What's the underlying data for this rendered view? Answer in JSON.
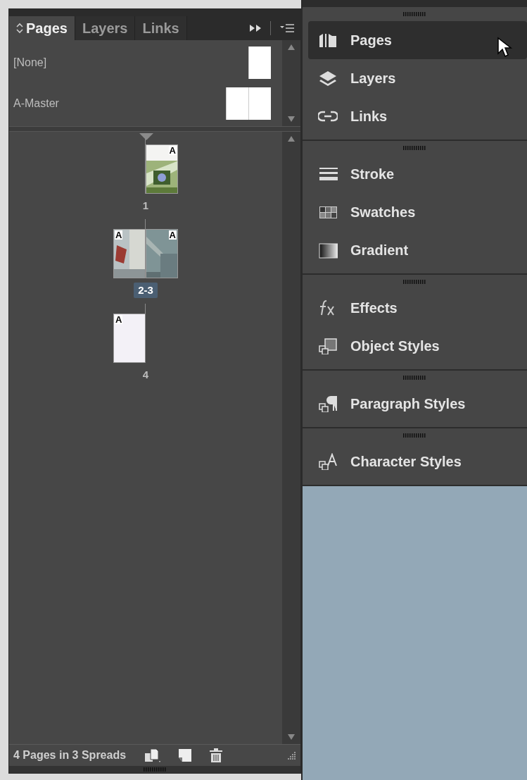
{
  "pages_panel": {
    "tabs": [
      {
        "label": "Pages",
        "selected": true
      },
      {
        "label": "Layers",
        "selected": false
      },
      {
        "label": "Links",
        "selected": false
      }
    ],
    "masters": [
      {
        "name": "[None]",
        "kind": "single"
      },
      {
        "name": "A-Master",
        "kind": "spread"
      }
    ],
    "spreads": [
      {
        "label": "1",
        "selected": false,
        "pages": [
          {
            "recto": true,
            "master": "A",
            "kind": "photo-green"
          }
        ]
      },
      {
        "label": "2-3",
        "selected": true,
        "pages": [
          {
            "recto": false,
            "master": "A",
            "kind": "photo-red"
          },
          {
            "recto": true,
            "master": "A",
            "kind": "photo-grey"
          }
        ]
      },
      {
        "label": "4",
        "selected": false,
        "pages": [
          {
            "recto": false,
            "master": "A",
            "kind": "blank"
          }
        ]
      }
    ],
    "status": "4 Pages in 3 Spreads"
  },
  "dock": {
    "groups": [
      {
        "items": [
          {
            "label": "Pages",
            "kind": "pages",
            "selected": true
          },
          {
            "label": "Layers",
            "kind": "layers",
            "selected": false
          },
          {
            "label": "Links",
            "kind": "links",
            "selected": false
          }
        ]
      },
      {
        "items": [
          {
            "label": "Stroke",
            "kind": "stroke",
            "selected": false
          },
          {
            "label": "Swatches",
            "kind": "swatches",
            "selected": false
          },
          {
            "label": "Gradient",
            "kind": "gradient",
            "selected": false
          }
        ]
      },
      {
        "items": [
          {
            "label": "Effects",
            "kind": "effects",
            "selected": false
          },
          {
            "label": "Object Styles",
            "kind": "object-styles",
            "selected": false
          }
        ]
      },
      {
        "items": [
          {
            "label": "Paragraph Styles",
            "kind": "paragraph-styles",
            "selected": false
          }
        ]
      },
      {
        "items": [
          {
            "label": "Character Styles",
            "kind": "character-styles",
            "selected": false
          }
        ]
      }
    ]
  }
}
